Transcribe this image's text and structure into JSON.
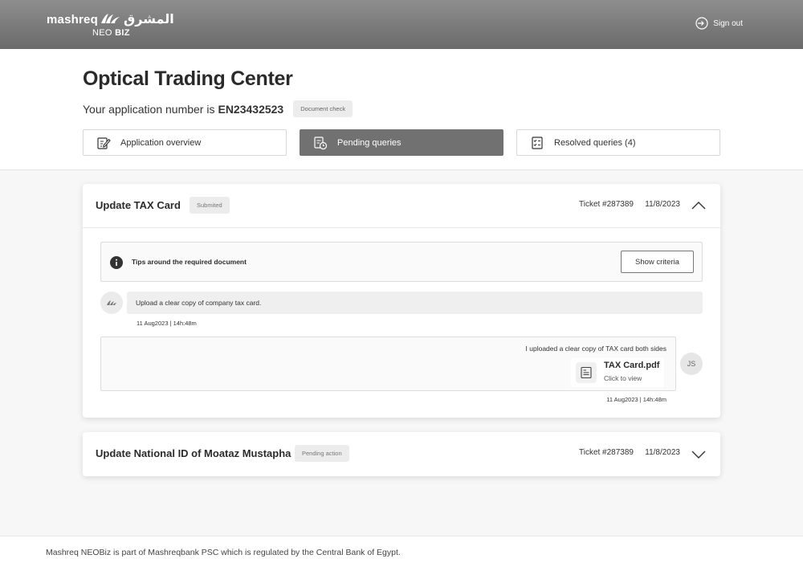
{
  "header": {
    "logo_en": "mashreq",
    "logo_ar": "المشرق",
    "logo_sub_a": "NEO",
    "logo_sub_b": "BIZ",
    "signout_label": "Sign out"
  },
  "application": {
    "company_name": "Optical Trading Center",
    "number_prefix": "Your application number is",
    "number": "EN23432523",
    "status_badge": "Document check"
  },
  "tabs": [
    {
      "label": "Application overview",
      "icon": "edit-document-icon",
      "active": false
    },
    {
      "label": "Pending queries",
      "icon": "pending-document-icon",
      "active": true
    },
    {
      "label": "Resolved queries (4)",
      "icon": "checklist-icon",
      "active": false
    }
  ],
  "queries": [
    {
      "title": "Update TAX Card",
      "status": "Submited",
      "ticket": "Ticket #287389",
      "date": "11/8/2023",
      "expanded": true,
      "tips_text": "Tips around the required document",
      "show_criteria_label": "Show criteria",
      "bank_message": "Upload a clear copy of company tax card.",
      "bank_time": "11 Aug2023 | 14h:48m",
      "user_message": "I uploaded a clear copy of TAX card both sides",
      "file_name": "TAX Card.pdf",
      "file_action": "Click to view",
      "user_initials": "JS",
      "user_time": "11 Aug2023 | 14h:48m"
    },
    {
      "title": "Update National ID of Moataz Mustapha",
      "status": "Pending action",
      "ticket": "Ticket #287389",
      "date": "11/8/2023",
      "expanded": false
    }
  ],
  "footer": {
    "text": "Mashreq NEOBiz is part of Mashreqbank PSC which is regulated by the Central Bank of Egypt."
  },
  "colors": {
    "header_bg": "#7a7a7a",
    "active_tab": "#717171",
    "page_bg": "#f7f7f7"
  }
}
